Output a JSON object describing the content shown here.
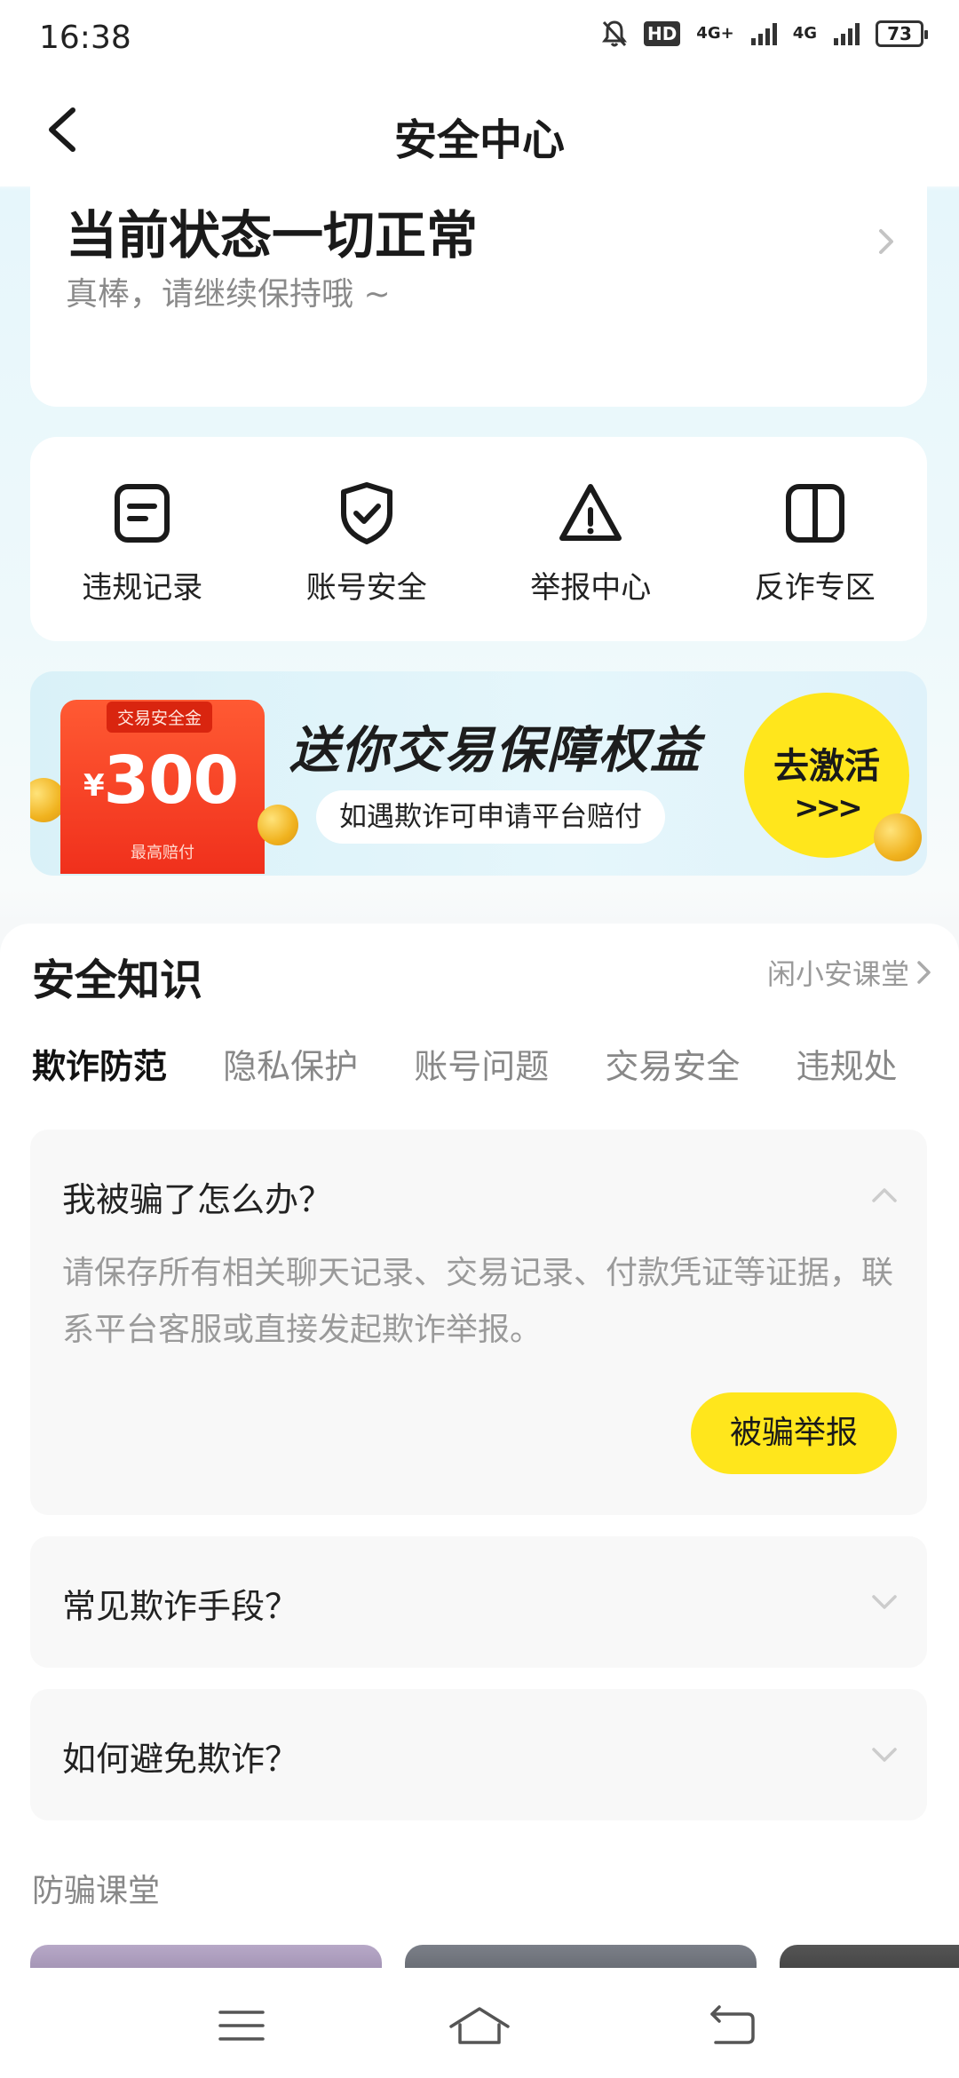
{
  "status_bar": {
    "time": "16:38",
    "hd_label": "HD",
    "net1": "4G+",
    "net2": "4G",
    "battery": "73"
  },
  "nav": {
    "title": "安全中心"
  },
  "status_card": {
    "title": "当前状态一切正常",
    "subtitle": "真棒，请继续保持哦 ~"
  },
  "quick_actions": [
    {
      "label": "违规记录",
      "icon": "document-icon"
    },
    {
      "label": "账号安全",
      "icon": "shield-check-icon"
    },
    {
      "label": "举报中心",
      "icon": "warning-icon"
    },
    {
      "label": "反诈专区",
      "icon": "book-icon"
    }
  ],
  "promo": {
    "voucher_tag": "交易安全金",
    "currency": "¥",
    "amount": "300",
    "voucher_note": "最高赔付",
    "headline": "送你交易保障权益",
    "subline": "如遇欺诈可申请平台赔付",
    "cta_label": "去激活",
    "cta_arrows": ">>>"
  },
  "knowledge": {
    "title": "安全知识",
    "link": "闲小安课堂",
    "tabs": [
      "欺诈防范",
      "隐私保护",
      "账号问题",
      "交易安全",
      "违规处"
    ],
    "active_tab": 0,
    "faqs": [
      {
        "question": "我被骗了怎么办？",
        "answer": "请保存所有相关聊天记录、交易记录、付款凭证等证据，联系平台客服或直接发起欺诈举报。",
        "button": "被骗举报",
        "expanded": true
      },
      {
        "question": "常见欺诈手段？",
        "expanded": false
      },
      {
        "question": "如何避免欺诈？",
        "expanded": false
      }
    ],
    "class_title": "防骗课堂"
  },
  "colors": {
    "accent_yellow": "#ffe61c",
    "voucher_red": "#f0301c",
    "muted_text": "#9a9a9a"
  }
}
